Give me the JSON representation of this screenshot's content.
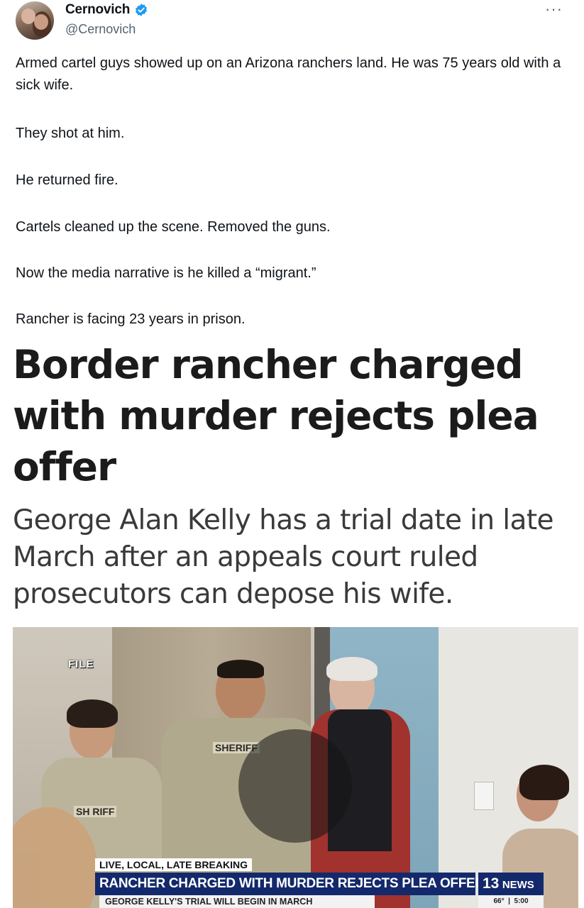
{
  "tweet": {
    "display_name": "Cernovich",
    "handle": "@Cernovich",
    "more_label": "···",
    "paragraphs": [
      "Armed cartel guys showed up on an Arizona ranchers land. He was 75 years old with a sick wife.",
      "They shot at him.",
      "He returned fire.",
      "Cartels cleaned up the scene. Removed the guns.",
      "Now the media narrative is he killed a “migrant.”",
      "Rancher is facing 23 years in prison."
    ],
    "colors": {
      "verified": "#1d9bf0",
      "text": "#0f1419",
      "secondary": "#536471"
    }
  },
  "article": {
    "headline": "Border rancher charged with murder rejects plea offer",
    "subhead": "George Alan Kelly has a trial date in late March after an appeals court ruled prosecutors can depose his wife."
  },
  "video": {
    "file_tag": "FILE",
    "patch_left": "SH  RIFF",
    "patch_center": "SHERIFF",
    "lower_third_top": "LIVE, LOCAL, LATE BREAKING",
    "lower_third_main": "RANCHER CHARGED WITH MURDER REJECTS PLEA OFFER",
    "lower_third_sub": "GEORGE KELLY'S TRIAL WILL BEGIN IN MARCH",
    "station_number": "13",
    "station_word": "NEWS",
    "temperature": "66°",
    "time": "5:00",
    "colors": {
      "banner": "#13296b"
    }
  }
}
